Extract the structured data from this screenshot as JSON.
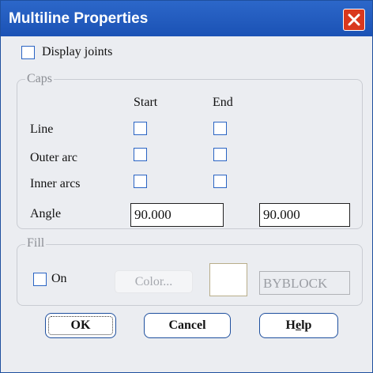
{
  "window": {
    "title": "Multiline Properties",
    "close_icon": "close-icon"
  },
  "display_joints": {
    "label": "Display joints",
    "checked": false
  },
  "caps": {
    "legend": "Caps",
    "col_start": "Start",
    "col_end": "End",
    "rows": [
      {
        "label": "Line",
        "start_checked": false,
        "end_checked": false
      },
      {
        "label": "Outer arc",
        "start_checked": false,
        "end_checked": false
      },
      {
        "label": "Inner arcs",
        "start_checked": false,
        "end_checked": false
      }
    ],
    "angle_label": "Angle",
    "angle_start": "90.000",
    "angle_end": "90.000"
  },
  "fill": {
    "legend": "Fill",
    "on_label": "On",
    "on_checked": false,
    "color_button": "Color...",
    "color_value": "BYBLOCK",
    "swatch_color": "#ffffff"
  },
  "buttons": {
    "ok": "OK",
    "cancel": "Cancel",
    "help_prefix": "H",
    "help_mnemonic": "e",
    "help_suffix": "lp"
  },
  "colors": {
    "titlebar": "#2c67c9",
    "close_button": "#d9381e",
    "dialog_bg": "#ebedf1",
    "accent_border": "#1e4f9e"
  }
}
